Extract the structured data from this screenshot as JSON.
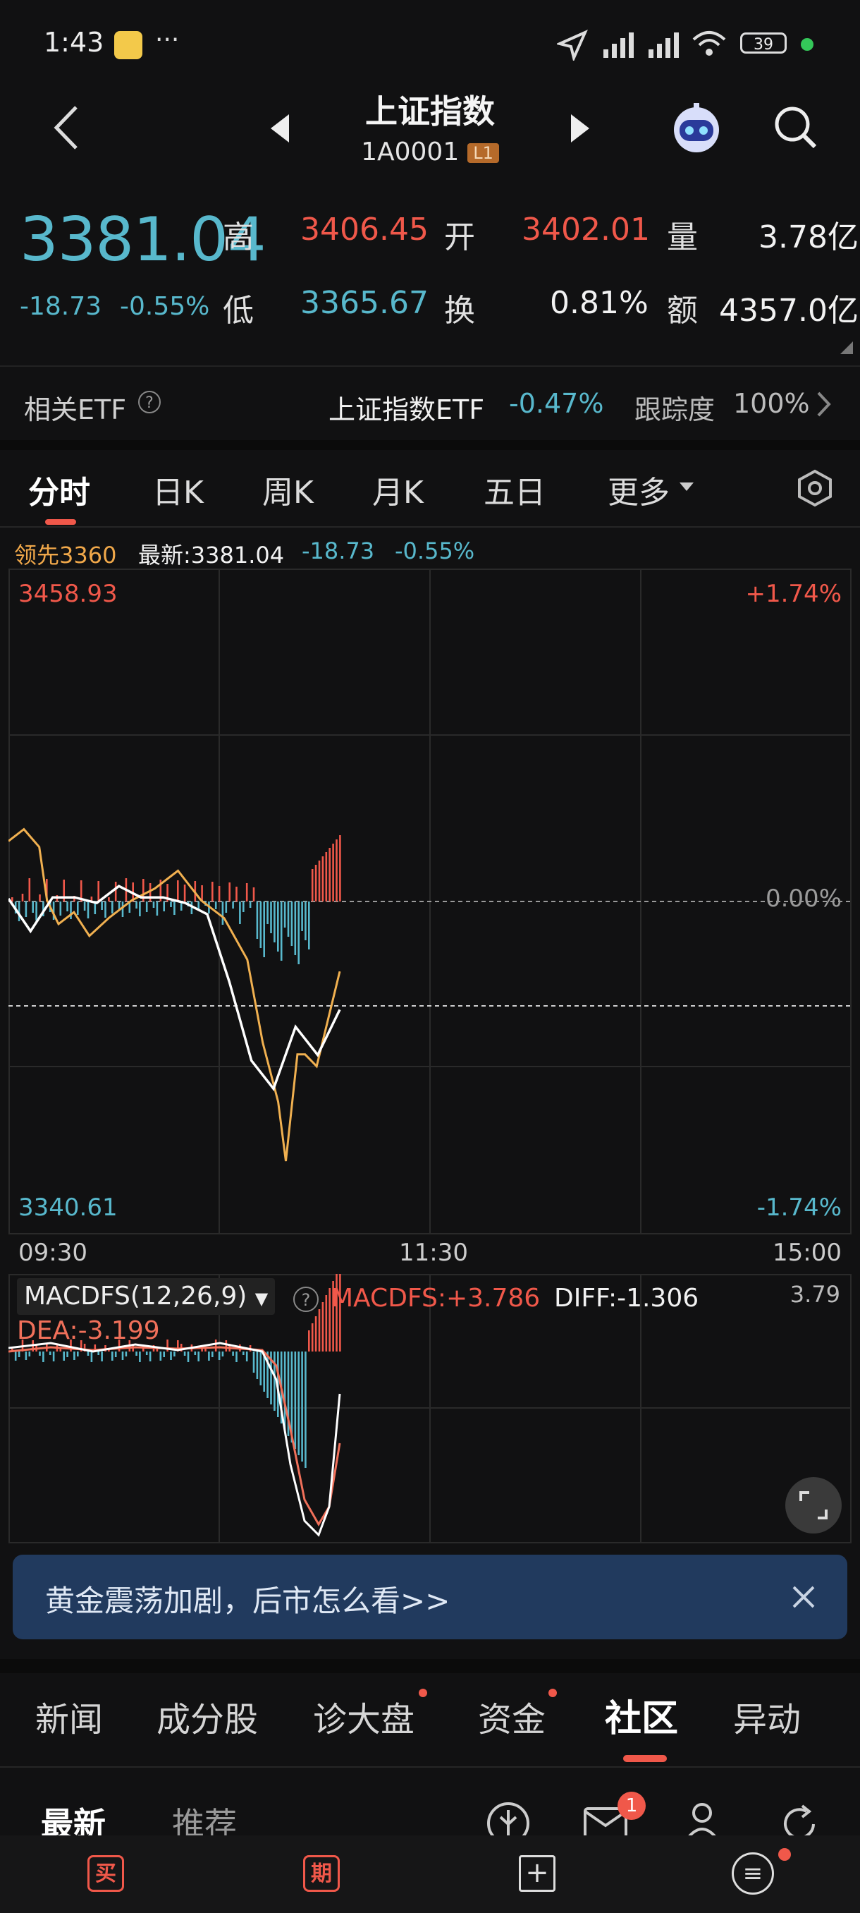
{
  "status": {
    "time": "1:43",
    "more": "···",
    "battery": "39"
  },
  "header": {
    "title": "上证指数",
    "code": "1A0001",
    "level_badge": "L1"
  },
  "quote": {
    "price": "3381.04",
    "change": "-18.73",
    "change_pct": "-0.55%",
    "high_label": "高",
    "high": "3406.45",
    "open_label": "开",
    "open": "3402.01",
    "volume_label": "量",
    "volume": "3.78亿",
    "low_label": "低",
    "low": "3365.67",
    "turnover_label": "换",
    "turnover": "0.81%",
    "amount_label": "额",
    "amount": "4357.0亿"
  },
  "etf": {
    "label": "相关ETF",
    "help": "?",
    "name": "上证指数ETF",
    "change": "-0.47%",
    "tracking_label": "跟踪度",
    "tracking": "100%"
  },
  "tabs": [
    "分时",
    "日K",
    "周K",
    "月K",
    "五日",
    "更多"
  ],
  "chart": {
    "lead_label": "领先3360",
    "latest_label": "最新:3381.04",
    "change": "-18.73",
    "change_pct": "-0.55%",
    "y_top": "3458.93",
    "y_top_pct": "+1.74%",
    "y_zero_pct": "0.00%",
    "y_bottom": "3340.61",
    "y_bottom_pct": "-1.74%",
    "x_start": "09:30",
    "x_mid": "11:30",
    "x_end": "15:00"
  },
  "macd": {
    "name": "MACDFS(12,26,9)",
    "help": "?",
    "macd_label": "MACDFS:+3.786",
    "diff_label": "DIFF:-1.306",
    "dea_label": "DEA:-3.199",
    "scale": "3.79"
  },
  "banner": {
    "text": "黄金震荡加剧，后市怎么看>>"
  },
  "nav_tabs": [
    "新闻",
    "成分股",
    "诊大盘",
    "资金",
    "社区",
    "异动"
  ],
  "sub_tabs": [
    "最新",
    "推荐"
  ],
  "message_badge": "1",
  "bottom": [
    "买",
    "期",
    "+",
    "≡"
  ],
  "colors": {
    "up": "#f0584a",
    "down": "#58b8cc",
    "price_line": "#ffffff",
    "avg_line": "#f0b050",
    "banner": "#213a5e"
  },
  "chart_data": {
    "type": "line",
    "title": "",
    "x": [
      "09:30",
      "11:30",
      "15:00"
    ],
    "ylim": [
      3340.61,
      3458.93
    ],
    "series": [
      {
        "values": [
          3399.77,
          3395,
          3400,
          3401,
          3399,
          3403,
          3400,
          3401,
          3399,
          3398,
          3385,
          3372,
          3366,
          3378,
          3372,
          3381.04
        ]
      }
    ]
  }
}
